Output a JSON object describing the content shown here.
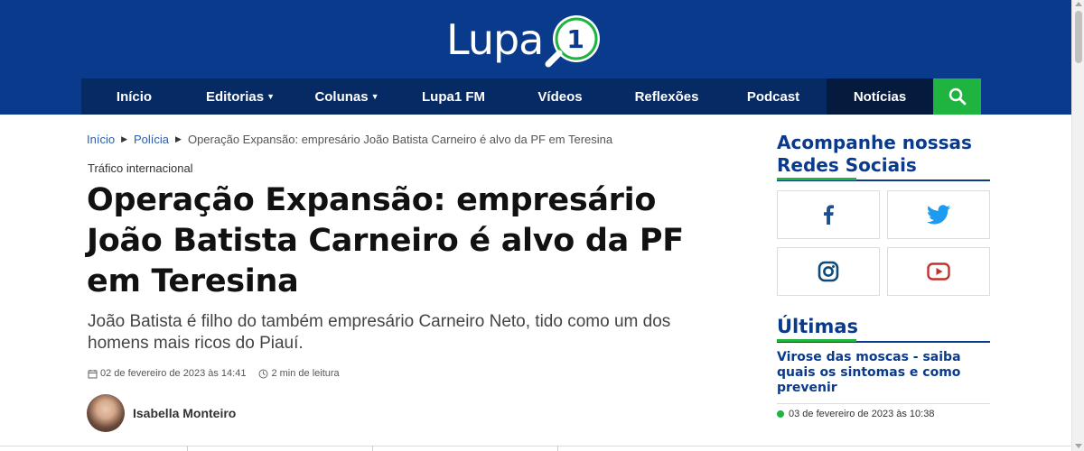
{
  "brand": {
    "logo_text": "Lupa",
    "logo_number": "1"
  },
  "nav": {
    "items": [
      {
        "label": "Início"
      },
      {
        "label": "Editorias",
        "caret": "▼"
      },
      {
        "label": "Colunas",
        "caret": "▼"
      },
      {
        "label": "Lupa1 FM"
      },
      {
        "label": "Vídeos"
      },
      {
        "label": "Reflexões"
      },
      {
        "label": "Podcast"
      },
      {
        "label": "Notícias"
      }
    ]
  },
  "breadcrumb": {
    "items": [
      "Início",
      "Polícia",
      "Operação Expansão: empresário João Batista Carneiro é alvo da PF em Teresina"
    ]
  },
  "article": {
    "kicker": "Tráfico internacional",
    "title": "Operação Expansão: empresário João Batista Carneiro é alvo da PF em Teresina",
    "subtitle": "João Batista é filho do também empresário Carneiro Neto, tido como um dos homens mais ricos do Piauí.",
    "date": "02 de fevereiro de 2023 às 14:41",
    "read_time": "2 min de leitura",
    "author": "Isabella Monteiro"
  },
  "sidebar": {
    "social_title": "Acompanhe nossas Redes Sociais",
    "social": [
      {
        "icon": "facebook-icon",
        "color": "#1d4e8f"
      },
      {
        "icon": "twitter-icon",
        "color": "#1d9bf0"
      },
      {
        "icon": "instagram-icon",
        "color": "#0f4a7a"
      },
      {
        "icon": "youtube-icon",
        "color": "#c4302b"
      }
    ],
    "latest_title": "Últimas",
    "latest": [
      {
        "title": "Virose das moscas - saiba quais os sintomas e como prevenir",
        "date": "03 de fevereiro de 2023 às 10:38"
      }
    ]
  },
  "colors": {
    "primary": "#0a3a8c",
    "accent": "#1fb340",
    "nav_dark": "#041b3e"
  }
}
